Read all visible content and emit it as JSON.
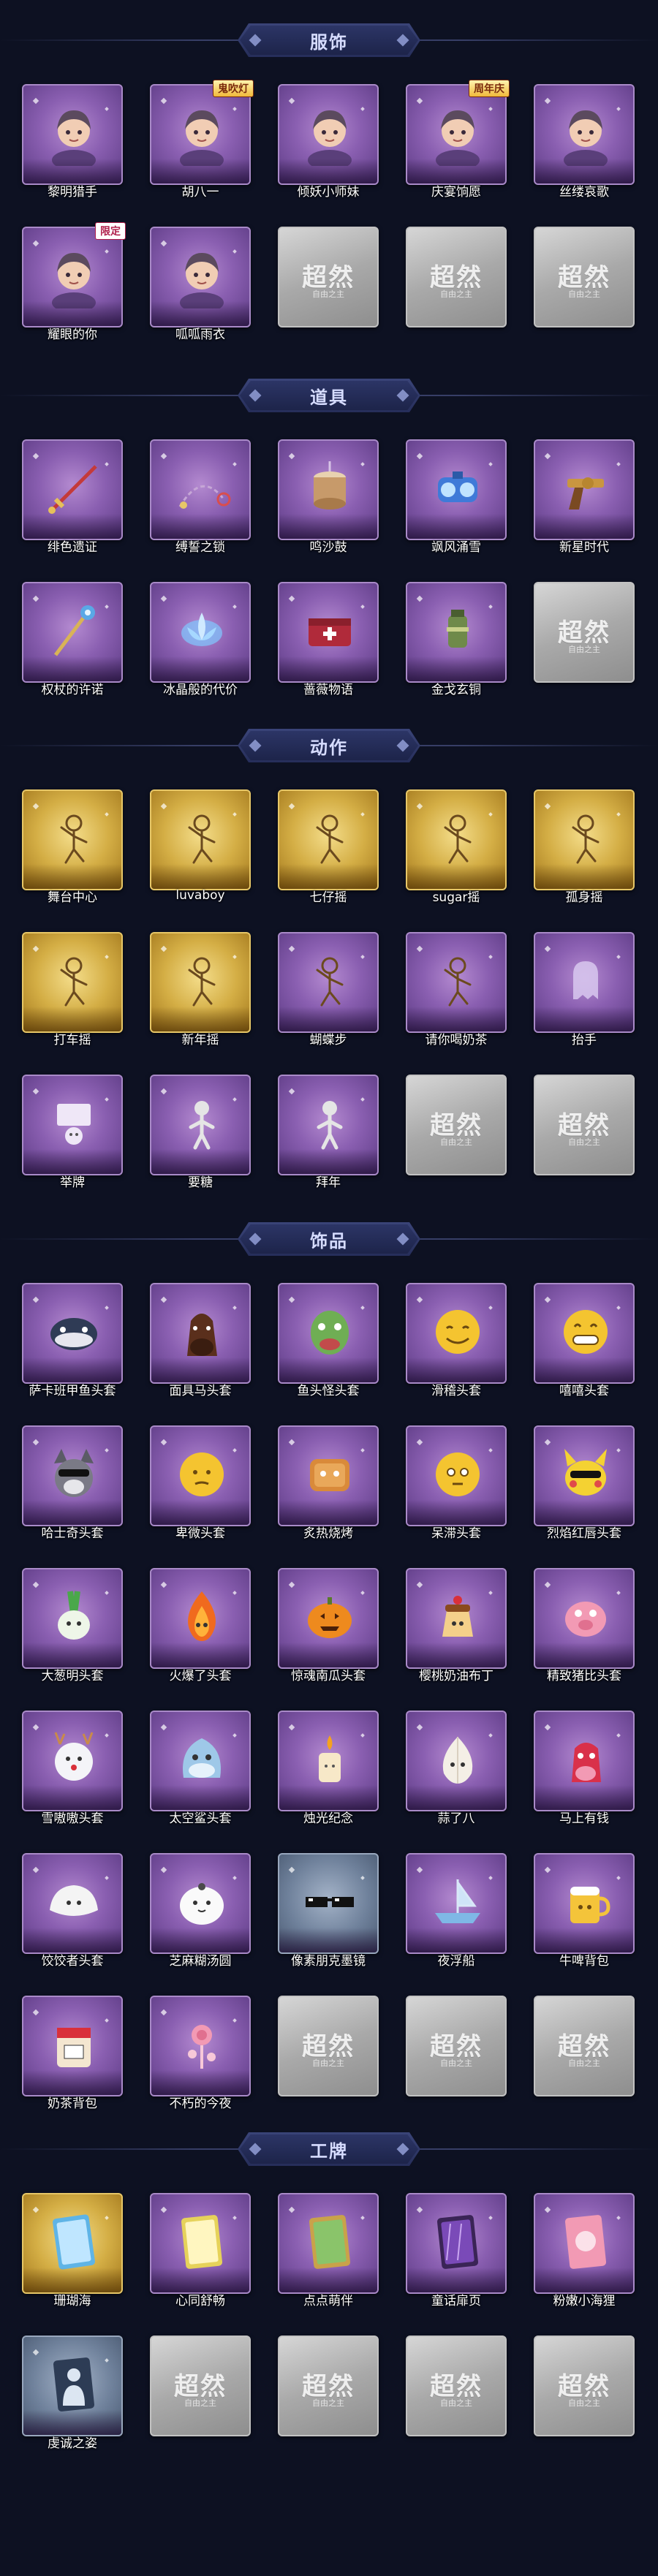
{
  "watermark": "超然",
  "watermark_sub": "自由之主",
  "sections": [
    {
      "title": "服饰",
      "items": [
        {
          "label": "黎明猎手",
          "tier": "purple",
          "icon": "portrait-hunter-icon",
          "art": "portrait"
        },
        {
          "label": "胡八一",
          "tier": "purple",
          "icon": "portrait-explorer-icon",
          "art": "portrait",
          "badge": "鬼吹灯",
          "badge_style": "gold"
        },
        {
          "label": "倾妖小师妹",
          "tier": "purple",
          "icon": "portrait-maiden-icon",
          "art": "portrait"
        },
        {
          "label": "庆宴饷愿",
          "tier": "purple",
          "icon": "portrait-banquet-icon",
          "art": "portrait",
          "badge": "周年庆",
          "badge_style": "gold"
        },
        {
          "label": "丝缕哀歌",
          "tier": "purple",
          "icon": "portrait-elegy-icon",
          "art": "portrait"
        },
        {
          "label": "耀眼的你",
          "tier": "purple",
          "icon": "portrait-cowgirl-icon",
          "art": "portrait",
          "badge": "限定",
          "badge_style": "red"
        },
        {
          "label": "呱呱雨衣",
          "tier": "purple",
          "icon": "portrait-frog-raincoat-icon",
          "art": "portrait"
        },
        {
          "label": "",
          "tier": "empty"
        },
        {
          "label": "",
          "tier": "empty"
        },
        {
          "label": "",
          "tier": "empty"
        }
      ]
    },
    {
      "title": "道具",
      "items": [
        {
          "label": "绯色遗证",
          "tier": "purple",
          "icon": "crimson-sword-icon",
          "art": "sword"
        },
        {
          "label": "缚誓之锁",
          "tier": "purple",
          "icon": "chain-lock-icon",
          "art": "chain"
        },
        {
          "label": "鸣沙鼓",
          "tier": "purple",
          "icon": "sand-drum-icon",
          "art": "drum"
        },
        {
          "label": "飒风涌雪",
          "tier": "purple",
          "icon": "snow-device-icon",
          "art": "device"
        },
        {
          "label": "新星时代",
          "tier": "purple",
          "icon": "revolver-icon",
          "art": "gun"
        },
        {
          "label": "权杖的许诺",
          "tier": "purple",
          "icon": "scepter-icon",
          "art": "scepter"
        },
        {
          "label": "冰晶般的代价",
          "tier": "purple",
          "icon": "ice-lotus-icon",
          "art": "lotus"
        },
        {
          "label": "蔷薇物语",
          "tier": "purple",
          "icon": "medical-box-icon",
          "art": "box"
        },
        {
          "label": "金戈玄铜",
          "tier": "purple",
          "icon": "bronze-lantern-icon",
          "art": "lantern"
        },
        {
          "label": "",
          "tier": "empty"
        }
      ]
    },
    {
      "title": "动作",
      "items": [
        {
          "label": "舞台中心",
          "tier": "gold",
          "icon": "dance-pose-icon",
          "art": "pose"
        },
        {
          "label": "luvaboy",
          "tier": "gold",
          "icon": "dance-pose-icon",
          "art": "pose"
        },
        {
          "label": "七仔摇",
          "tier": "gold",
          "icon": "dance-pose-icon",
          "art": "pose"
        },
        {
          "label": "sugar摇",
          "tier": "gold",
          "icon": "dance-pose-icon",
          "art": "pose"
        },
        {
          "label": "孤身摇",
          "tier": "gold",
          "icon": "dance-pose-icon",
          "art": "pose"
        },
        {
          "label": "打车摇",
          "tier": "gold",
          "icon": "dance-pose-icon",
          "art": "pose"
        },
        {
          "label": "新年摇",
          "tier": "gold",
          "icon": "dance-pose-icon",
          "art": "pose"
        },
        {
          "label": "蝴蝶步",
          "tier": "purple",
          "icon": "butterfly-step-icon",
          "art": "pose"
        },
        {
          "label": "请你喝奶茶",
          "tier": "purple",
          "icon": "milk-tea-pose-icon",
          "art": "pose"
        },
        {
          "label": "抬手",
          "tier": "purple",
          "icon": "raise-hand-icon",
          "art": "ghost"
        },
        {
          "label": "举牌",
          "tier": "purple",
          "icon": "hold-sign-icon",
          "art": "sign"
        },
        {
          "label": "要糖",
          "tier": "purple",
          "icon": "ask-candy-icon",
          "art": "pose-grey"
        },
        {
          "label": "拜年",
          "tier": "purple",
          "icon": "new-year-greeting-icon",
          "art": "pose-grey"
        },
        {
          "label": "",
          "tier": "empty"
        },
        {
          "label": "",
          "tier": "empty"
        }
      ]
    },
    {
      "title": "饰品",
      "items": [
        {
          "label": "萨卡班甲鱼头套",
          "tier": "purple",
          "icon": "fish-head-icon",
          "art": "fish"
        },
        {
          "label": "面具马头套",
          "tier": "purple",
          "icon": "horse-head-icon",
          "art": "horse"
        },
        {
          "label": "鱼头怪头套",
          "tier": "purple",
          "icon": "fishman-head-icon",
          "art": "greenfish"
        },
        {
          "label": "滑稽头套",
          "tier": "purple",
          "icon": "smiley-face-icon",
          "art": "smile"
        },
        {
          "label": "嘻嘻头套",
          "tier": "purple",
          "icon": "grin-face-icon",
          "art": "grin"
        },
        {
          "label": "哈士奇头套",
          "tier": "purple",
          "icon": "husky-head-icon",
          "art": "dog"
        },
        {
          "label": "卑微头套",
          "tier": "purple",
          "icon": "humble-face-icon",
          "art": "humble"
        },
        {
          "label": "炙热烧烤",
          "tier": "purple",
          "icon": "bbq-head-icon",
          "art": "toast"
        },
        {
          "label": "呆滞头套",
          "tier": "purple",
          "icon": "blank-face-icon",
          "art": "blank"
        },
        {
          "label": "烈焰红唇头套",
          "tier": "purple",
          "icon": "pikachu-head-icon",
          "art": "pika"
        },
        {
          "label": "大葱明头套",
          "tier": "purple",
          "icon": "scallion-head-icon",
          "art": "scallion"
        },
        {
          "label": "火爆了头套",
          "tier": "purple",
          "icon": "fire-head-icon",
          "art": "fire"
        },
        {
          "label": "惊魂南瓜头套",
          "tier": "purple",
          "icon": "pumpkin-head-icon",
          "art": "pumpkin"
        },
        {
          "label": "樱桃奶油布丁",
          "tier": "purple",
          "icon": "pudding-head-icon",
          "art": "pudding"
        },
        {
          "label": "精致猪比头套",
          "tier": "purple",
          "icon": "pig-head-icon",
          "art": "pig"
        },
        {
          "label": "雪嗷嗷头套",
          "tier": "purple",
          "icon": "snow-deer-head-icon",
          "art": "deer"
        },
        {
          "label": "太空鲨头套",
          "tier": "purple",
          "icon": "space-shark-head-icon",
          "art": "shark"
        },
        {
          "label": "烛光纪念",
          "tier": "purple",
          "icon": "candle-head-icon",
          "art": "candle"
        },
        {
          "label": "蒜了八",
          "tier": "purple",
          "icon": "garlic-head-icon",
          "art": "garlic"
        },
        {
          "label": "马上有钱",
          "tier": "purple",
          "icon": "lucky-horse-icon",
          "art": "redhorse"
        },
        {
          "label": "饺饺者头套",
          "tier": "purple",
          "icon": "dumpling-head-icon",
          "art": "dumpling"
        },
        {
          "label": "芝麻糊汤圆",
          "tier": "purple",
          "icon": "tangyuan-head-icon",
          "art": "tangyuan"
        },
        {
          "label": "像素朋克墨镜",
          "tier": "bluegrey",
          "icon": "pixel-sunglasses-icon",
          "art": "glasses"
        },
        {
          "label": "夜浮船",
          "tier": "purple",
          "icon": "night-boat-icon",
          "art": "boat"
        },
        {
          "label": "牛啤背包",
          "tier": "purple",
          "icon": "beer-backpack-icon",
          "art": "beer"
        },
        {
          "label": "奶茶背包",
          "tier": "purple",
          "icon": "milk-tea-backpack-icon",
          "art": "teabag"
        },
        {
          "label": "不朽的今夜",
          "tier": "purple",
          "icon": "immortal-night-icon",
          "art": "rose"
        },
        {
          "label": "",
          "tier": "empty"
        },
        {
          "label": "",
          "tier": "empty"
        },
        {
          "label": "",
          "tier": "empty"
        }
      ]
    },
    {
      "title": "工牌",
      "items": [
        {
          "label": "珊瑚海",
          "tier": "gold",
          "icon": "coral-sea-card-icon",
          "art": "card-blue"
        },
        {
          "label": "心同舒畅",
          "tier": "purple",
          "icon": "heart-card-icon",
          "art": "card-yellow"
        },
        {
          "label": "点点萌伴",
          "tier": "purple",
          "icon": "cute-partner-card-icon",
          "art": "card-green"
        },
        {
          "label": "童话扉页",
          "tier": "purple",
          "icon": "fairy-page-card-icon",
          "art": "card-purple"
        },
        {
          "label": "粉嫩小海狸",
          "tier": "purple",
          "icon": "pink-beaver-card-icon",
          "art": "card-pink"
        },
        {
          "label": "虔诚之姿",
          "tier": "bluegrey",
          "icon": "devout-pose-card-icon",
          "art": "card-silhouette"
        },
        {
          "label": "",
          "tier": "empty"
        },
        {
          "label": "",
          "tier": "empty"
        },
        {
          "label": "",
          "tier": "empty"
        },
        {
          "label": "",
          "tier": "empty"
        }
      ]
    }
  ]
}
